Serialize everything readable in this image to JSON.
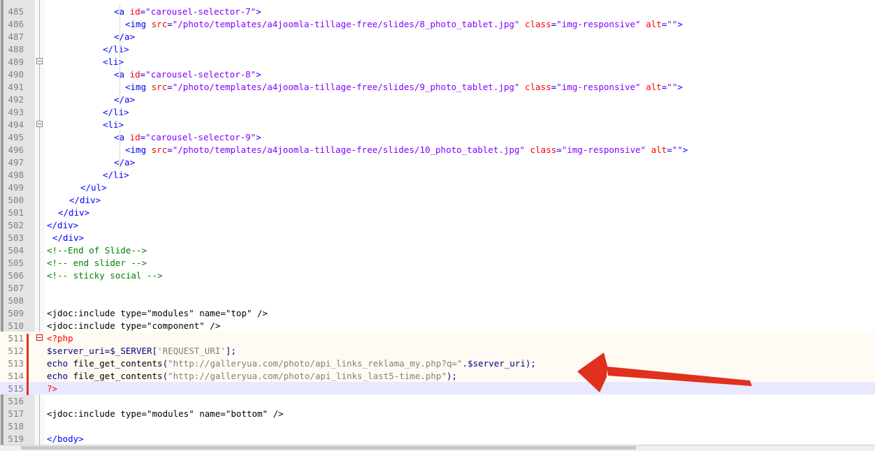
{
  "editor": {
    "lines": [
      {
        "n": "485",
        "segs": [
          {
            "t": "<a ",
            "c": "t"
          },
          {
            "t": "id",
            "c": "a"
          },
          {
            "t": "=",
            "c": "t"
          },
          {
            "t": "\"carousel-selector-7\"",
            "c": "v"
          },
          {
            "t": ">",
            "c": "t"
          }
        ]
      },
      {
        "n": "486",
        "segs": [
          {
            "t": "<img ",
            "c": "t"
          },
          {
            "t": "src",
            "c": "a"
          },
          {
            "t": "=",
            "c": "t"
          },
          {
            "t": "\"/photo/templates/a4joomla-tillage-free/slides/8_photo_tablet.jpg\"",
            "c": "v"
          },
          {
            "t": " ",
            "c": ""
          },
          {
            "t": "class",
            "c": "a"
          },
          {
            "t": "=",
            "c": "t"
          },
          {
            "t": "\"img-responsive\"",
            "c": "v"
          },
          {
            "t": " ",
            "c": ""
          },
          {
            "t": "alt",
            "c": "a"
          },
          {
            "t": "=",
            "c": "t"
          },
          {
            "t": "\"\"",
            "c": "v"
          },
          {
            "t": ">",
            "c": "t"
          }
        ]
      },
      {
        "n": "487",
        "segs": [
          {
            "t": "</a>",
            "c": "t"
          }
        ]
      },
      {
        "n": "488",
        "segs": [
          {
            "t": "</li>",
            "c": "t"
          }
        ]
      },
      {
        "n": "489",
        "segs": [
          {
            "t": "<li>",
            "c": "t"
          }
        ]
      },
      {
        "n": "490",
        "segs": [
          {
            "t": "<a ",
            "c": "t"
          },
          {
            "t": "id",
            "c": "a"
          },
          {
            "t": "=",
            "c": "t"
          },
          {
            "t": "\"carousel-selector-8\"",
            "c": "v"
          },
          {
            "t": ">",
            "c": "t"
          }
        ]
      },
      {
        "n": "491",
        "segs": [
          {
            "t": "<img ",
            "c": "t"
          },
          {
            "t": "src",
            "c": "a"
          },
          {
            "t": "=",
            "c": "t"
          },
          {
            "t": "\"/photo/templates/a4joomla-tillage-free/slides/9_photo_tablet.jpg\"",
            "c": "v"
          },
          {
            "t": " ",
            "c": ""
          },
          {
            "t": "class",
            "c": "a"
          },
          {
            "t": "=",
            "c": "t"
          },
          {
            "t": "\"img-responsive\"",
            "c": "v"
          },
          {
            "t": " ",
            "c": ""
          },
          {
            "t": "alt",
            "c": "a"
          },
          {
            "t": "=",
            "c": "t"
          },
          {
            "t": "\"\"",
            "c": "v"
          },
          {
            "t": ">",
            "c": "t"
          }
        ]
      },
      {
        "n": "492",
        "segs": [
          {
            "t": "</a>",
            "c": "t"
          }
        ]
      },
      {
        "n": "493",
        "segs": [
          {
            "t": "</li>",
            "c": "t"
          }
        ]
      },
      {
        "n": "494",
        "segs": [
          {
            "t": "<li>",
            "c": "t"
          }
        ]
      },
      {
        "n": "495",
        "segs": [
          {
            "t": "<a ",
            "c": "t"
          },
          {
            "t": "id",
            "c": "a"
          },
          {
            "t": "=",
            "c": "t"
          },
          {
            "t": "\"carousel-selector-9\"",
            "c": "v"
          },
          {
            "t": ">",
            "c": "t"
          }
        ]
      },
      {
        "n": "496",
        "segs": [
          {
            "t": "<img ",
            "c": "t"
          },
          {
            "t": "src",
            "c": "a"
          },
          {
            "t": "=",
            "c": "t"
          },
          {
            "t": "\"/photo/templates/a4joomla-tillage-free/slides/10_photo_tablet.jpg\"",
            "c": "v"
          },
          {
            "t": " ",
            "c": ""
          },
          {
            "t": "class",
            "c": "a"
          },
          {
            "t": "=",
            "c": "t"
          },
          {
            "t": "\"img-responsive\"",
            "c": "v"
          },
          {
            "t": " ",
            "c": ""
          },
          {
            "t": "alt",
            "c": "a"
          },
          {
            "t": "=",
            "c": "t"
          },
          {
            "t": "\"\"",
            "c": "v"
          },
          {
            "t": ">",
            "c": "t"
          }
        ]
      },
      {
        "n": "497",
        "segs": [
          {
            "t": "</a>",
            "c": "t"
          }
        ]
      },
      {
        "n": "498",
        "segs": [
          {
            "t": "</li>",
            "c": "t"
          }
        ]
      },
      {
        "n": "499",
        "segs": [
          {
            "t": "</ul>",
            "c": "t"
          }
        ]
      },
      {
        "n": "500",
        "segs": [
          {
            "t": "</div>",
            "c": "t"
          }
        ]
      },
      {
        "n": "501",
        "segs": [
          {
            "t": "</div>",
            "c": "t"
          }
        ]
      },
      {
        "n": "502",
        "segs": [
          {
            "t": "</div>",
            "c": "t"
          }
        ]
      },
      {
        "n": "503",
        "segs": [
          {
            "t": "</div>",
            "c": "t"
          }
        ]
      },
      {
        "n": "504",
        "segs": [
          {
            "t": "<!--End of Slide-->",
            "c": "c"
          }
        ]
      },
      {
        "n": "505",
        "segs": [
          {
            "t": "<!-- end slider -->",
            "c": "c"
          }
        ]
      },
      {
        "n": "506",
        "segs": [
          {
            "t": "<!-- sticky social -->",
            "c": "c"
          }
        ]
      },
      {
        "n": "507",
        "segs": []
      },
      {
        "n": "508",
        "segs": []
      },
      {
        "n": "509",
        "segs": [
          {
            "t": "<jdoc:include type=\"modules\" name=\"top\" />",
            "c": ""
          }
        ]
      },
      {
        "n": "510",
        "segs": [
          {
            "t": "<jdoc:include type=\"component\" />",
            "c": ""
          }
        ]
      },
      {
        "n": "511",
        "segs": [
          {
            "t": "<?php",
            "c": "p"
          }
        ]
      },
      {
        "n": "512",
        "segs": [
          {
            "t": "$server_uri",
            "c": "vr"
          },
          {
            "t": "=",
            "c": "k"
          },
          {
            "t": "$_SERVER",
            "c": "vr"
          },
          {
            "t": "[",
            "c": "k"
          },
          {
            "t": "'REQUEST_URI'",
            "c": "s"
          },
          {
            "t": "];",
            "c": "k"
          }
        ]
      },
      {
        "n": "513",
        "segs": [
          {
            "t": "echo",
            "c": "k"
          },
          {
            "t": " file_get_contents",
            "c": ""
          },
          {
            "t": "(",
            "c": "k"
          },
          {
            "t": "\"http://galleryua.com/photo/api_links_reklama_my.php?q=\"",
            "c": "s"
          },
          {
            "t": ".",
            "c": "k"
          },
          {
            "t": "$server_uri",
            "c": "vr"
          },
          {
            "t": ");",
            "c": "k"
          }
        ]
      },
      {
        "n": "514",
        "segs": [
          {
            "t": "echo",
            "c": "k"
          },
          {
            "t": " file_get_contents",
            "c": ""
          },
          {
            "t": "(",
            "c": "k"
          },
          {
            "t": "\"http://galleryua.com/photo/api_links_last5-time.php\"",
            "c": "s"
          },
          {
            "t": ");",
            "c": "k"
          }
        ]
      },
      {
        "n": "515",
        "segs": [
          {
            "t": "?>",
            "c": "p"
          }
        ]
      },
      {
        "n": "516",
        "segs": []
      },
      {
        "n": "517",
        "segs": [
          {
            "t": "<jdoc:include type=\"modules\" name=\"bottom\" />",
            "c": ""
          }
        ]
      },
      {
        "n": "518",
        "segs": []
      },
      {
        "n": "519",
        "segs": [
          {
            "t": "</body>",
            "c": "t"
          }
        ]
      }
    ]
  },
  "colors": {
    "tag": "#0000ff",
    "attribute": "#ff0000",
    "value": "#8000ff",
    "comment": "#008000",
    "annotation_arrow": "#e0301e"
  }
}
